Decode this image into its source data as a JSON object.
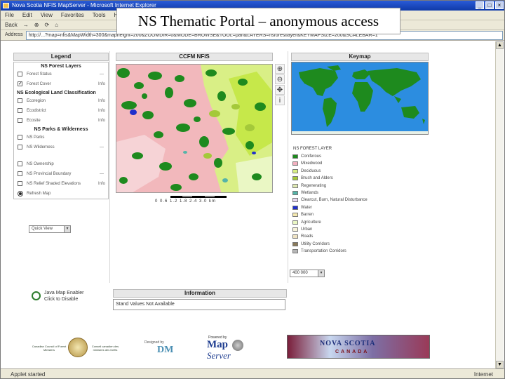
{
  "overlay_title": "NS Thematic Portal – anonymous access",
  "browser": {
    "title": "Nova Scotia NFIS MapServer - Microsoft Internet Explorer",
    "menu": [
      "File",
      "Edit",
      "View",
      "Favorites",
      "Tools",
      "Help"
    ],
    "toolbar": [
      "Back",
      "→",
      "⊗",
      "⟳",
      "⌂"
    ],
    "address_label": "Address",
    "url": "http://...?map=nfis&MapWidth=300&mapheight=200&ZOOMDIR=0&MODE=BROWSE&TOOL=pan&LAYERS=nsforestlayer&KEYMAPSIZE=200&SCALEBAR=1",
    "status_left": "Applet started",
    "status_zone": "Internet"
  },
  "legend": {
    "title": "Legend",
    "group_forest": "NS Forest Layers",
    "forest_rows": [
      {
        "label": "Forest Status",
        "checked": false,
        "tag": "—"
      },
      {
        "label": "Forest Cover",
        "checked": true,
        "tag": "Info"
      }
    ],
    "group_elc": "NS Ecological Land Classification",
    "elc_rows": [
      {
        "label": "Ecoregion",
        "checked": false,
        "tag": "Info"
      },
      {
        "label": "Ecodistrict",
        "checked": false,
        "tag": "Info"
      },
      {
        "label": "Ecosite",
        "checked": false,
        "tag": "Info"
      }
    ],
    "group_parks": "NS Parks & Wilderness",
    "parks_rows": [
      {
        "label": "NS Parks",
        "checked": false,
        "tag": ""
      },
      {
        "label": "NS Wilderness",
        "checked": false,
        "tag": "—"
      }
    ],
    "other_rows": [
      {
        "label": "NS Ownership",
        "checked": false,
        "tag": ""
      },
      {
        "label": "NS Provincial Boundary",
        "checked": false,
        "tag": "—"
      },
      {
        "label": "NS Relief Shaded Elevations",
        "checked": false,
        "tag": "Info"
      }
    ],
    "refresh_label": "Refresh Map",
    "quick_view": "Quick View"
  },
  "map": {
    "title": "CCFM NFIS",
    "scale_label": "0 0.6 1.2 1.8 2.4 3.0 km",
    "tools": [
      "⊕",
      "⊖",
      "✥",
      "i"
    ]
  },
  "keymap": {
    "title": "Keymap",
    "layer_title": "NS FOREST LAYER",
    "items": [
      {
        "label": "Coniferous",
        "color": "#1e8a1e"
      },
      {
        "label": "Mixedwood",
        "color": "#f2b0bf"
      },
      {
        "label": "Deciduous",
        "color": "#d9ef86"
      },
      {
        "label": "Brush and Alders",
        "color": "#a4c93a"
      },
      {
        "label": "Regenerating",
        "color": "#dfe9b3"
      },
      {
        "label": "Wetlands",
        "color": "#55b4a8"
      },
      {
        "label": "Clearcut, Burn, Natural Disturbance",
        "color": "#e6d7f0"
      },
      {
        "label": "Water",
        "color": "#1f2fcc"
      },
      {
        "label": "Barren",
        "color": "#f5e9b0"
      },
      {
        "label": "Agriculture",
        "color": "#eaf7c4"
      },
      {
        "label": "Urban",
        "color": "#f7f3da"
      },
      {
        "label": "Roads",
        "color": "#efe3c3"
      },
      {
        "label": "Utility Corridors",
        "color": "#8a7a5a"
      },
      {
        "label": "Transportation Corridors",
        "color": "#b7b7b7"
      }
    ],
    "scale_select": "400 000"
  },
  "java": {
    "line1": "Java Map Enabler",
    "line2": "Click to Disable"
  },
  "information": {
    "title": "Information",
    "text": "Stand Values Not Available"
  },
  "logos": {
    "ccfm_left": "Canadian Council of Forest Ministers",
    "ccfm_right": "Conseil canadien des ministres des forêts",
    "dm_by": "Designed by",
    "dm_mark": "DM",
    "ms_powered": "Powered by",
    "ms_map": "Map",
    "ms_server": "Server",
    "ns_main": "NOVA SCOTIA",
    "ns_sub": "CANADA"
  }
}
